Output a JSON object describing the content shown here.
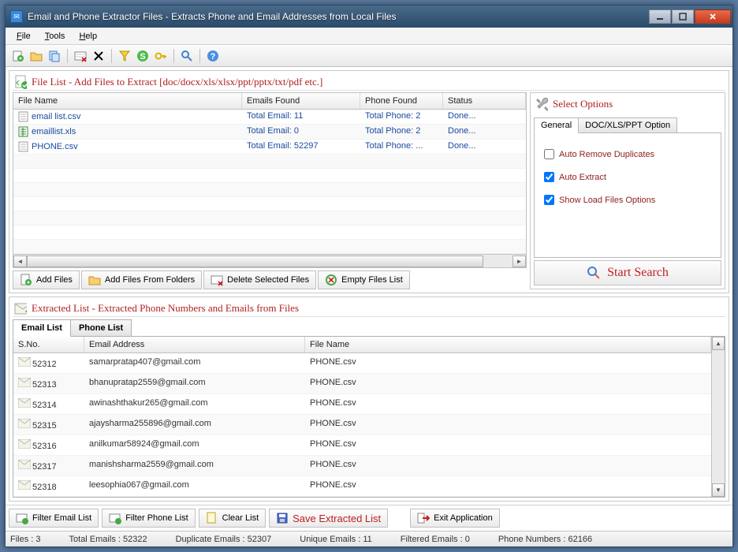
{
  "titlebar": {
    "text": "Email and Phone Extractor Files  -  Extracts Phone and Email Addresses from Local Files"
  },
  "menu": {
    "file": "File",
    "tools": "Tools",
    "help": "Help"
  },
  "file_list": {
    "heading": "File List - Add Files to Extract  [doc/docx/xls/xlsx/ppt/pptx/txt/pdf etc.]",
    "columns": {
      "name": "File Name",
      "emails": "Emails Found",
      "phone": "Phone Found",
      "status": "Status"
    },
    "rows": [
      {
        "name": "email list.csv",
        "emails": "Total Email: 11",
        "phone": "Total Phone: 2",
        "status": "Done..."
      },
      {
        "name": "emaillist.xls",
        "emails": "Total Email: 0",
        "phone": "Total Phone: 2",
        "status": "Done..."
      },
      {
        "name": "PHONE.csv",
        "emails": "Total Email: 52297",
        "phone": "Total Phone: ...",
        "status": "Done..."
      }
    ],
    "buttons": {
      "add_files": "Add Files",
      "add_folders": "Add Files From Folders",
      "delete_selected": "Delete Selected Files",
      "empty_list": "Empty Files List"
    }
  },
  "options": {
    "heading": "Select Options",
    "tab_general": "General",
    "tab_doc": "DOC/XLS/PPT Option",
    "auto_remove_dup": "Auto Remove Duplicates",
    "auto_extract": "Auto Extract",
    "show_load": "Show Load Files Options",
    "start_search": "Start Search"
  },
  "extracted": {
    "heading": "Extracted List - Extracted Phone Numbers and Emails from Files",
    "tab_email": "Email List",
    "tab_phone": "Phone List",
    "columns": {
      "sno": "S.No.",
      "email": "Email Address",
      "file": "File Name"
    },
    "rows": [
      {
        "sno": "52312",
        "email": "samarpratap407@gmail.com",
        "file": "PHONE.csv"
      },
      {
        "sno": "52313",
        "email": "bhanupratap2559@gmail.com",
        "file": "PHONE.csv"
      },
      {
        "sno": "52314",
        "email": "awinashthakur265@gmail.com",
        "file": "PHONE.csv"
      },
      {
        "sno": "52315",
        "email": "ajaysharma255896@gmail.com",
        "file": "PHONE.csv"
      },
      {
        "sno": "52316",
        "email": "anilkumar58924@gmail.com",
        "file": "PHONE.csv"
      },
      {
        "sno": "52317",
        "email": "manishsharma2559@gmail.com",
        "file": "PHONE.csv"
      },
      {
        "sno": "52318",
        "email": "leesophia067@gmail.com",
        "file": "PHONE.csv"
      }
    ]
  },
  "bottom": {
    "filter_email": "Filter Email List",
    "filter_phone": "Filter Phone List",
    "clear_list": "Clear List",
    "save_extracted": "Save Extracted List",
    "exit": "Exit Application"
  },
  "status": {
    "files": "Files :  3",
    "total_emails": "Total Emails :  52322",
    "dup_emails": "Duplicate Emails :  52307",
    "unique_emails": "Unique Emails :  11",
    "filtered_emails": "Filtered Emails :  0",
    "phone_numbers": "Phone Numbers :  62166"
  }
}
